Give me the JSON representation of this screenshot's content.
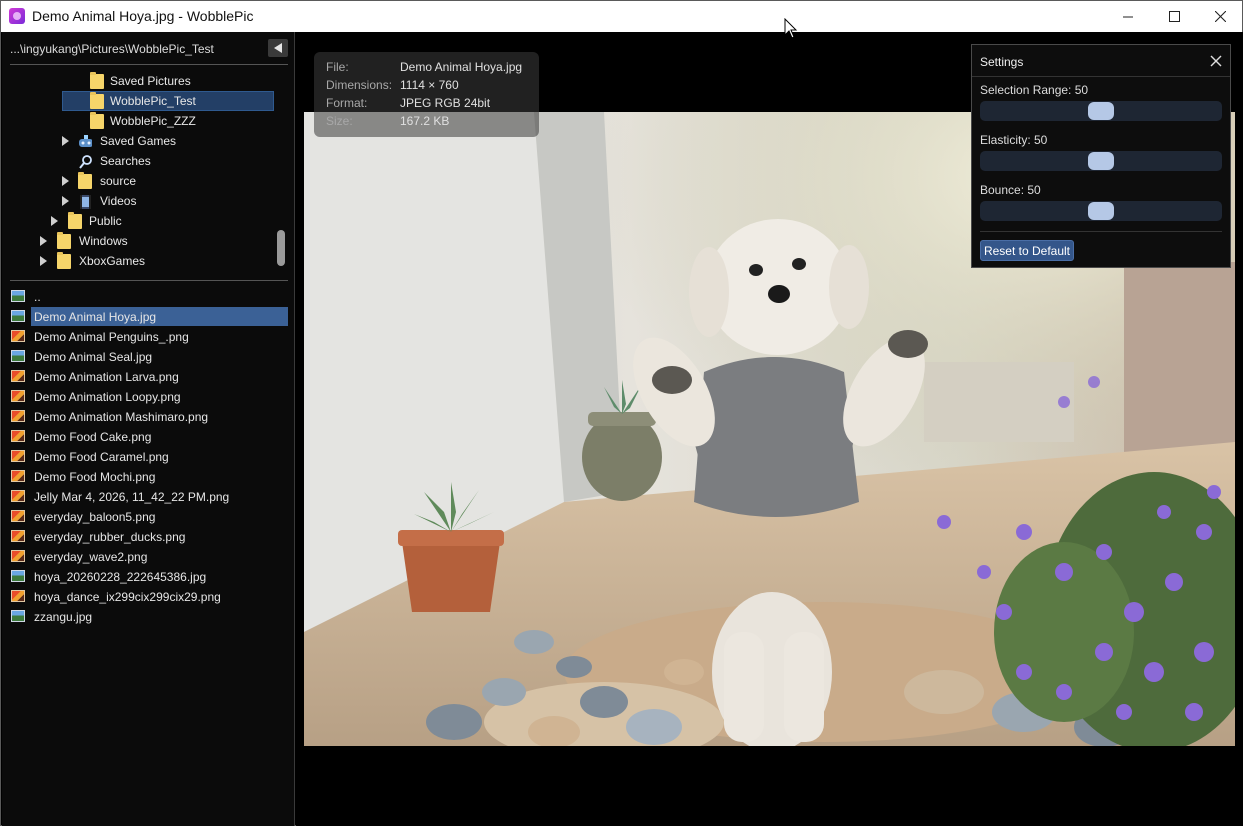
{
  "window": {
    "title": "Demo Animal Hoya.jpg - WobblePic",
    "icon": "wobblepic-app-icon"
  },
  "path_bar": {
    "path": "...\\ingyukang\\Pictures\\WobblePic_Test",
    "collapse_icon": "triangle-left-icon"
  },
  "folder_tree": [
    {
      "label": "Saved Pictures",
      "icon": "folder-icon",
      "expandable": false,
      "level": 3
    },
    {
      "label": "WobblePic_Test",
      "icon": "folder-icon",
      "expandable": false,
      "level": 3,
      "selected": true
    },
    {
      "label": "WobblePic_ZZZ",
      "icon": "folder-icon",
      "expandable": false,
      "level": 3
    },
    {
      "label": "Saved Games",
      "icon": "saved-games-icon",
      "expandable": true,
      "level": 2
    },
    {
      "label": "Searches",
      "icon": "search-icon",
      "expandable": false,
      "level": 2
    },
    {
      "label": "source",
      "icon": "folder-icon",
      "expandable": true,
      "level": 2
    },
    {
      "label": "Videos",
      "icon": "video-folder-icon",
      "expandable": true,
      "level": 2
    },
    {
      "label": "Public",
      "icon": "folder-icon",
      "expandable": true,
      "level": 1
    },
    {
      "label": "Windows",
      "icon": "folder-icon",
      "expandable": true,
      "level": 0
    },
    {
      "label": "XboxGames",
      "icon": "folder-icon",
      "expandable": true,
      "level": 0
    }
  ],
  "file_list": [
    {
      "label": "..",
      "type": "jpg"
    },
    {
      "label": "Demo Animal Hoya.jpg",
      "type": "jpg",
      "selected": true
    },
    {
      "label": "Demo Animal Penguins_.png",
      "type": "png"
    },
    {
      "label": "Demo Animal Seal.jpg",
      "type": "jpg"
    },
    {
      "label": "Demo Animation Larva.png",
      "type": "png"
    },
    {
      "label": "Demo Animation Loopy.png",
      "type": "png"
    },
    {
      "label": "Demo Animation Mashimaro.png",
      "type": "png"
    },
    {
      "label": "Demo Food Cake.png",
      "type": "png"
    },
    {
      "label": "Demo Food Caramel.png",
      "type": "png"
    },
    {
      "label": "Demo Food Mochi.png",
      "type": "png"
    },
    {
      "label": "Jelly Mar 4, 2026, 11_42_22 PM.png",
      "type": "png"
    },
    {
      "label": "everyday_baloon5.png",
      "type": "png"
    },
    {
      "label": "everyday_rubber_ducks.png",
      "type": "png"
    },
    {
      "label": "everyday_wave2.png",
      "type": "png"
    },
    {
      "label": "hoya_20260228_222645386.jpg",
      "type": "jpg"
    },
    {
      "label": "hoya_dance_ix299cix299cix29.png",
      "type": "png"
    },
    {
      "label": "zzangu.jpg",
      "type": "jpg"
    }
  ],
  "image_info": {
    "file_key": "File:",
    "file_value": "Demo Animal Hoya.jpg",
    "dimensions_key": "Dimensions:",
    "dimensions_value": "1114 × 760",
    "format_key": "Format:",
    "format_value": "JPEG RGB 24bit",
    "size_key": "Size:",
    "size_value": "167.2 KB"
  },
  "settings": {
    "title": "Settings",
    "sliders": [
      {
        "label": "Selection Range: 50",
        "value": 50,
        "max": 100
      },
      {
        "label": "Elasticity: 50",
        "value": 50,
        "max": 100
      },
      {
        "label": "Bounce: 50",
        "value": 50,
        "max": 100
      }
    ],
    "reset_label": "Reset to Default",
    "accent": "#34568a"
  },
  "colors": {
    "selection_tree": "#233f66",
    "selection_file": "#3b6196",
    "folder": "#f6d56a"
  }
}
